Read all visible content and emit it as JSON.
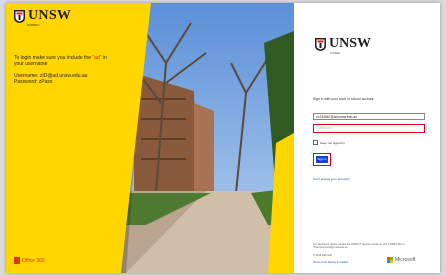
{
  "left": {
    "brand": "UNSW",
    "brand_sub": "SYDNEY",
    "hint_prefix": "To login make sure you include the",
    "hint_ad": "\"ad\"",
    "hint_suffix": "in your username",
    "username_line": "Username: zID@ad.unsw.edu.au",
    "password_line": "Password: zPass",
    "office": "Office 365"
  },
  "right": {
    "brand": "UNSW",
    "brand_sub": "SYDNEY",
    "instruction": "Sign in with your work or school account",
    "username_value": "z1234567@ad.unsw.edu.au",
    "password_placeholder": "Password",
    "keep_signed_in": "Keep me signed in",
    "sign_in": "Sign in",
    "cant_access": "Can't access your account?",
    "help": "For assistance please contact the UNSW IT Service Centre on +61 2 9385 1333 or ITServiceCentre@unsw.edu.au",
    "copyright": "© 2016 Microsoft",
    "terms": "Terms of use    Privacy & Cookies",
    "microsoft": "Microsoft"
  },
  "colors": {
    "unsw_yellow": "#ffd600",
    "highlight_red": "#e3001b",
    "button_blue": "#1e40c8"
  }
}
